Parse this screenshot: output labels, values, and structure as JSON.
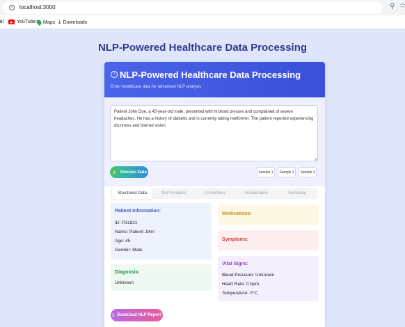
{
  "browser": {
    "url": "localhost:3000",
    "bookmarks": [
      {
        "label": "ail",
        "icon": "gmail-icon"
      },
      {
        "label": "YouTube",
        "icon": "youtube-icon"
      },
      {
        "label": "Maps",
        "icon": "maps-icon"
      },
      {
        "label": "Downloads",
        "icon": "download-icon"
      }
    ]
  },
  "page": {
    "title": "NLP-Powered Healthcare Data Processing"
  },
  "card": {
    "title": "NLP-Powered Healthcare Data Processing",
    "subtitle": "Enter healthcare data for advanced NLP analysis",
    "header_icon": "info-icon",
    "input_text": "Patient John Doe, a 45-year-old male, presented with hi blood presure and complained of severe headaches. He has a history of diabetis and is currently taking metformin. The patient reported experiencing dizziness and blurred vision.",
    "process_label": "Process Data",
    "process_icon": "bolt-icon",
    "samples": [
      "Sample 1",
      "Sample 2",
      "Sample 3"
    ],
    "tabs": [
      "Structured Data",
      "NLP Analysis",
      "Corrections",
      "Visualization",
      "Summary"
    ],
    "active_tab": "Structured Data"
  },
  "structured": {
    "patient": {
      "title": "Patient Information:",
      "lines": [
        "ID: P31821",
        "Name: Patient John",
        "Age: 45",
        "Gender: Male"
      ]
    },
    "diagnosis": {
      "title": "Diagnosis:",
      "value": "Unknown"
    },
    "medications": {
      "title": "Medications:"
    },
    "symptoms": {
      "title": "Symptoms:"
    },
    "vitals": {
      "title": "Vital Signs:",
      "lines": [
        "Blood Pressure: Unknown",
        "Heart Rate: 0 bpm",
        "Temperature: 0°C"
      ]
    }
  },
  "download_label": "Download NLP Report",
  "colors": {
    "accent": "#4a64ea",
    "process_gradient": [
      "#38c87f",
      "#2f8fd8"
    ],
    "download_gradient": [
      "#b86ce0",
      "#e95a9a"
    ]
  }
}
